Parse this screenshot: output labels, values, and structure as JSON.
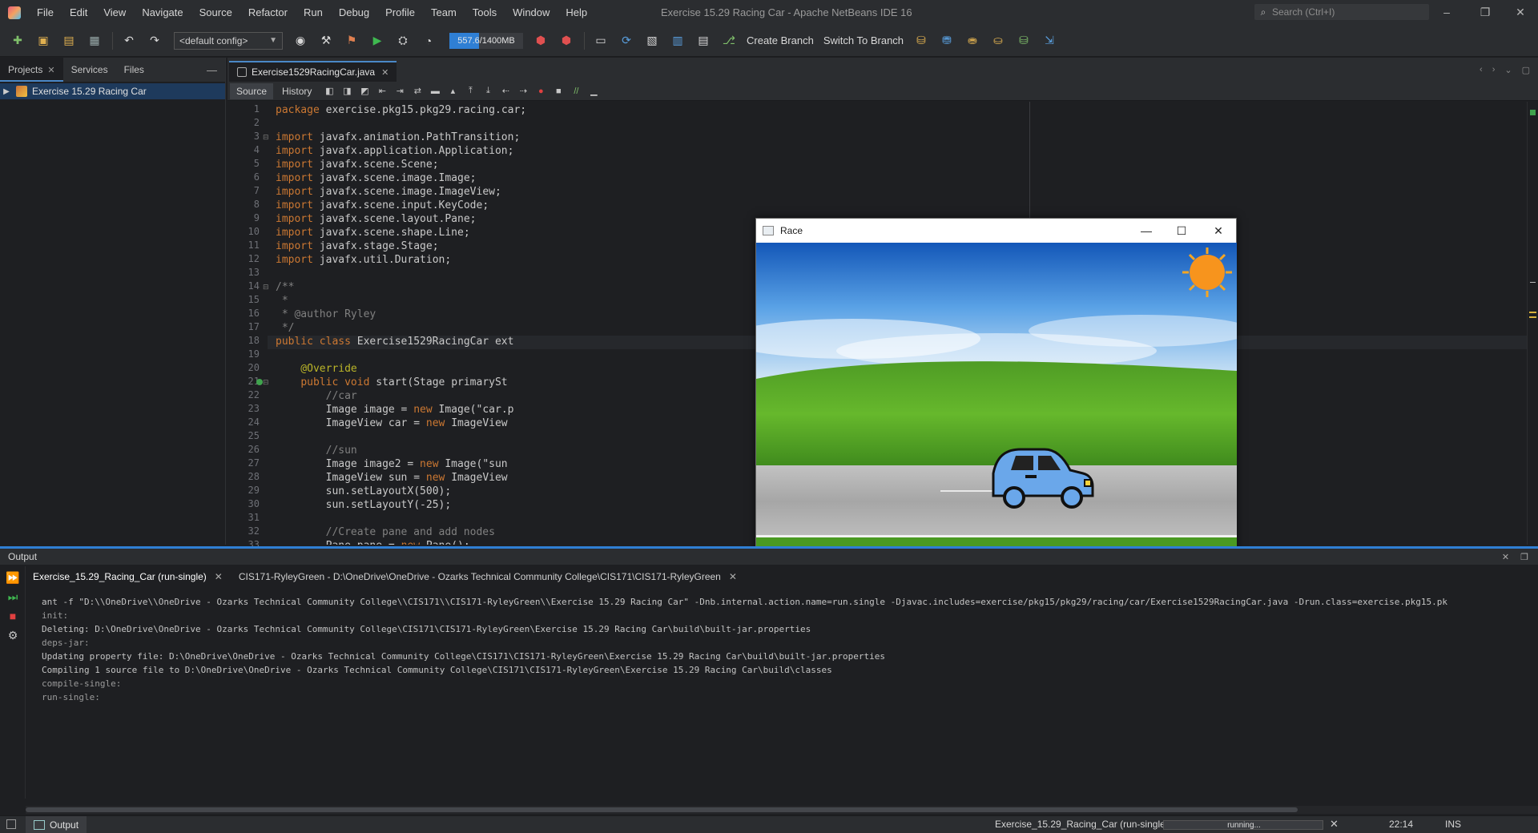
{
  "window": {
    "title": "Exercise 15.29 Racing Car - Apache NetBeans IDE 16",
    "search_placeholder": "Search (Ctrl+I)",
    "controls": [
      "–",
      "❐",
      "✕"
    ]
  },
  "menu": [
    "File",
    "Edit",
    "View",
    "Navigate",
    "Source",
    "Refactor",
    "Run",
    "Debug",
    "Profile",
    "Team",
    "Tools",
    "Window",
    "Help"
  ],
  "toolbar": {
    "config": "<default config>",
    "memory": "557.6/1400MB",
    "memory_fraction": 0.398,
    "create_branch": "Create Branch",
    "switch_branch": "Switch To Branch"
  },
  "left_panel": {
    "tabs": [
      "Projects",
      "Services",
      "Files"
    ],
    "minimize": "—",
    "tree_item": "Exercise 15.29 Racing Car"
  },
  "editor": {
    "tab_label": "Exercise1529RacingCar.java",
    "subtabs": [
      "Source",
      "History"
    ]
  },
  "code_lines": [
    {
      "n": "1",
      "text": "package exercise.pkg15.pkg29.racing.car;"
    },
    {
      "n": "2",
      "text": ""
    },
    {
      "n": "3",
      "text": "import javafx.animation.PathTransition;"
    },
    {
      "n": "4",
      "text": "import javafx.application.Application;"
    },
    {
      "n": "5",
      "text": "import javafx.scene.Scene;"
    },
    {
      "n": "6",
      "text": "import javafx.scene.image.Image;"
    },
    {
      "n": "7",
      "text": "import javafx.scene.image.ImageView;"
    },
    {
      "n": "8",
      "text": "import javafx.scene.input.KeyCode;"
    },
    {
      "n": "9",
      "text": "import javafx.scene.layout.Pane;"
    },
    {
      "n": "10",
      "text": "import javafx.scene.shape.Line;"
    },
    {
      "n": "11",
      "text": "import javafx.stage.Stage;"
    },
    {
      "n": "12",
      "text": "import javafx.util.Duration;"
    },
    {
      "n": "13",
      "text": ""
    },
    {
      "n": "14",
      "text": "/**"
    },
    {
      "n": "15",
      "text": " *"
    },
    {
      "n": "16",
      "text": " * @author Ryley"
    },
    {
      "n": "17",
      "text": " */"
    },
    {
      "n": "18",
      "text": "public class Exercise1529RacingCar ext"
    },
    {
      "n": "19",
      "text": ""
    },
    {
      "n": "20",
      "text": "    @Override"
    },
    {
      "n": "21",
      "text": "    public void start(Stage primarySt"
    },
    {
      "n": "22",
      "text": "        //car"
    },
    {
      "n": "23",
      "text": "        Image image = new Image(\"car.p"
    },
    {
      "n": "24",
      "text": "        ImageView car = new ImageView"
    },
    {
      "n": "25",
      "text": ""
    },
    {
      "n": "26",
      "text": "        //sun"
    },
    {
      "n": "27",
      "text": "        Image image2 = new Image(\"sun"
    },
    {
      "n": "28",
      "text": "        ImageView sun = new ImageView"
    },
    {
      "n": "29",
      "text": "        sun.setLayoutX(500);"
    },
    {
      "n": "30",
      "text": "        sun.setLayoutY(-25);"
    },
    {
      "n": "31",
      "text": ""
    },
    {
      "n": "32",
      "text": "        //Create pane and add nodes"
    },
    {
      "n": "33",
      "text": "        Pane pane = new Pane();"
    }
  ],
  "race_window": {
    "title": "Race",
    "controls": [
      "—",
      "☐",
      "✕"
    ]
  },
  "output": {
    "title": "Output",
    "controls": [
      "✕",
      "❐"
    ],
    "tabs": [
      {
        "label": "Exercise_15.29_Racing_Car (run-single)"
      },
      {
        "label": "CIS171-RyleyGreen - D:\\OneDrive\\OneDrive - Ozarks Technical Community College\\CIS171\\CIS171-RyleyGreen"
      }
    ],
    "lines": [
      "ant -f \"D:\\\\OneDrive\\\\OneDrive - Ozarks Technical Community College\\\\CIS171\\\\CIS171-RyleyGreen\\\\Exercise 15.29 Racing Car\" -Dnb.internal.action.name=run.single -Djavac.includes=exercise/pkg15/pkg29/racing/car/Exercise1529RacingCar.java -Drun.class=exercise.pkg15.pk",
      "init:",
      "Deleting: D:\\OneDrive\\OneDrive - Ozarks Technical Community College\\CIS171\\CIS171-RyleyGreen\\Exercise 15.29 Racing Car\\build\\built-jar.properties",
      "deps-jar:",
      "Updating property file: D:\\OneDrive\\OneDrive - Ozarks Technical Community College\\CIS171\\CIS171-RyleyGreen\\Exercise 15.29 Racing Car\\build\\built-jar.properties",
      "Compiling 1 source file to D:\\OneDrive\\OneDrive - Ozarks Technical Community College\\CIS171\\CIS171-RyleyGreen\\Exercise 15.29 Racing Car\\build\\classes",
      "compile-single:",
      "run-single:"
    ]
  },
  "statusbar": {
    "output_button": "Output",
    "task": "Exercise_15.29_Racing_Car (run-single)",
    "progress": "running...",
    "cancel": "✕",
    "position": "22:14",
    "mode": "INS"
  },
  "colors": {
    "accent": "#2f7fd4",
    "background": "#1e1f22",
    "panel": "#2b2d30",
    "keyword": "#cc7832"
  }
}
